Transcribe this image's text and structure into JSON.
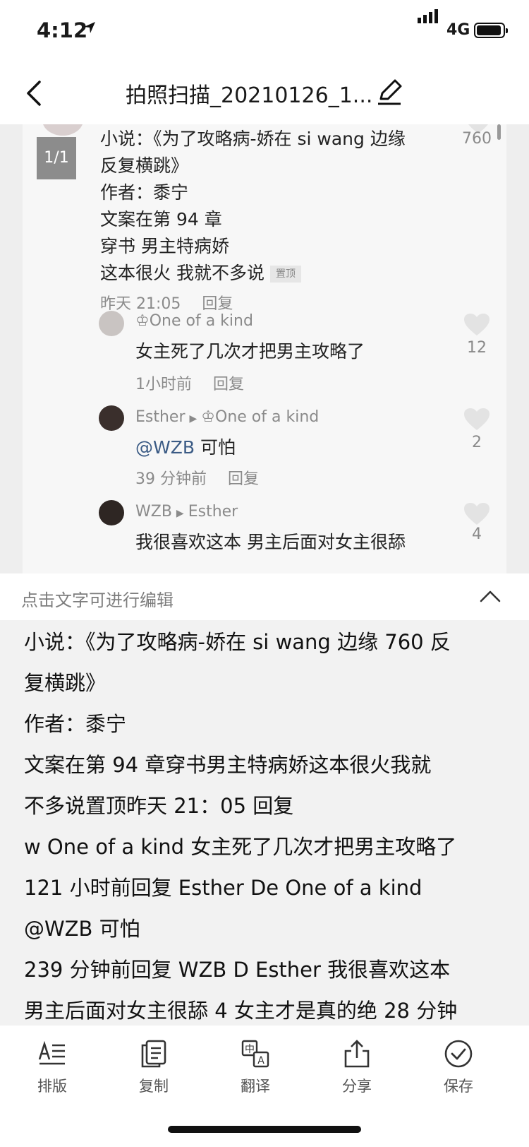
{
  "status": {
    "time": "4:12",
    "network": "4G"
  },
  "nav": {
    "title": "拍照扫描_20210126_1..."
  },
  "photo": {
    "page_badge": "1/1",
    "post": {
      "lines": [
        "小说：《为了攻略病-娇在 si wang 边缘",
        "反复横跳》",
        "作者：黍宁",
        "文案在第 94 章",
        "穿书 男主特病娇",
        "这本很火 我就不多说"
      ],
      "pin_label": "置顶",
      "time": "昨天 21:05",
      "reply": "回复",
      "likes": "760"
    },
    "replies": [
      {
        "name": "♔One of a kind",
        "text": "女主死了几次才把男主攻略了",
        "time": "1小时前",
        "reply": "回复",
        "likes": "12"
      },
      {
        "name": "Esther",
        "target": "♔One of a kind",
        "mention": "@WZB",
        "text": "可怕",
        "time": "39 分钟前",
        "reply": "回复",
        "likes": "2"
      },
      {
        "name": "WZB",
        "target": "Esther",
        "text": "我很喜欢这本 男主后面对女主很舔",
        "likes": "4"
      }
    ]
  },
  "hint": {
    "text": "点击文字可进行编辑"
  },
  "ocr_lines": [
    "小说：《为了攻略病-娇在 si wang 边缘 760 反",
    "复横跳》",
    "作者：黍宁",
    "文案在第 94 章穿书男主特病娇这本很火我就",
    "不多说置顶昨天 21：05 回复",
    "w One of a kind 女主死了几次才把男主攻略了",
    "121 小时前回复 Esther De One of a kind",
    "@WZB 可怕",
    "239 分钟前回复 WZB D Esther 我很喜欢这本",
    "男主后面对女主很舔 4 女主才是真的绝 28 分钟"
  ],
  "toolbar": [
    {
      "label": "排版",
      "icon": "layout-icon"
    },
    {
      "label": "复制",
      "icon": "copy-icon"
    },
    {
      "label": "翻译",
      "icon": "translate-icon"
    },
    {
      "label": "分享",
      "icon": "share-icon"
    },
    {
      "label": "保存",
      "icon": "save-check-icon"
    }
  ]
}
